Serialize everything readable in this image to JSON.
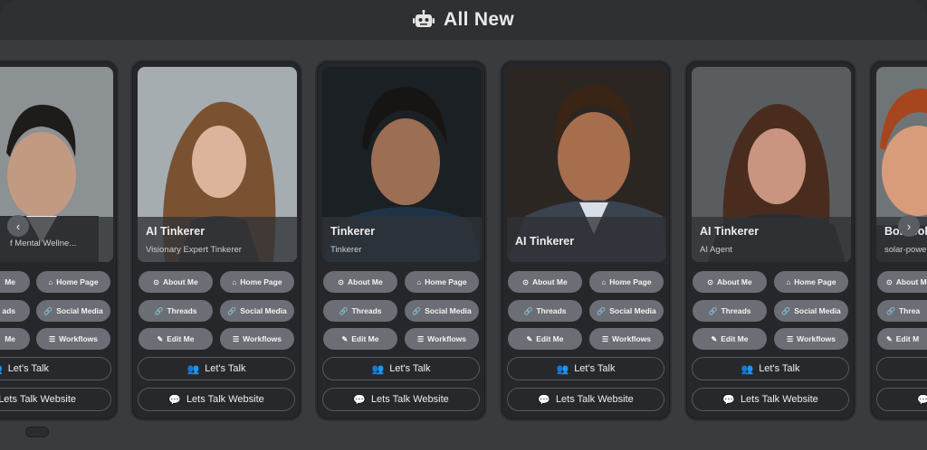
{
  "header": {
    "title": "All New",
    "icon": "robot-icon"
  },
  "cards": [
    {
      "name": "",
      "role": "f Mental Wellne...",
      "photo_tone": "#8a8f93"
    },
    {
      "name": "AI Tinkerer",
      "role": "Visionary Expert Tinkerer",
      "photo_tone": "#a2a9ad"
    },
    {
      "name": "Tinkerer",
      "role": "Tinkerer",
      "photo_tone": "#1c2226"
    },
    {
      "name": "AI Tinkerer",
      "role": "",
      "photo_tone": "#2b2621"
    },
    {
      "name": "AI Tinkerer",
      "role": "AI Agent",
      "photo_tone": "#5b5e61"
    },
    {
      "name": "Bob Bols",
      "role": "solar-power",
      "photo_tone": "#6f7477"
    }
  ],
  "buttons": {
    "about": "About Me",
    "home": "Home Page",
    "threads": "Threads",
    "social": "Social Media",
    "edit": "Edit Me",
    "workflows": "Workflows",
    "lets_talk": "Let's Talk",
    "website": "Lets Talk Website"
  },
  "partial": {
    "left_about": "Me",
    "left_threads": "ads",
    "left_edit": "Me",
    "right_about": "About M",
    "right_threads": "Threa",
    "right_edit": "Edit M"
  },
  "nav": {
    "prev": "‹",
    "next": "›"
  }
}
